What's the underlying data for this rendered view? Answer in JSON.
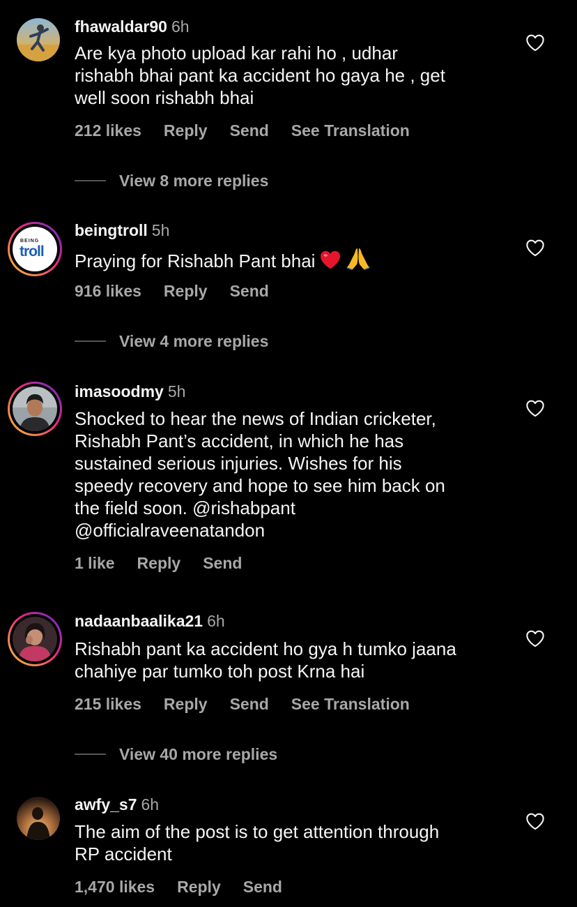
{
  "comments": [
    {
      "username": "fhawaldar90",
      "time": "6h",
      "text": "Are kya photo upload kar rahi ho , udhar\nrishabh bhai pant ka accident ho gaya he , get\nwell soon rishabh bhai",
      "likes": "212 likes",
      "reply": "Reply",
      "send": "Send",
      "translation": "See Translation",
      "view_replies": "View 8 more replies"
    },
    {
      "username": "beingtroll",
      "time": "5h",
      "text": "Praying for Rishabh Pant bhai",
      "likes": "916 likes",
      "reply": "Reply",
      "send": "Send",
      "view_replies": "View 4 more replies",
      "avatar_logo_top": "BEING",
      "avatar_logo_main": "troll"
    },
    {
      "username": "imasoodmy",
      "time": "5h",
      "text": "Shocked to hear the news of Indian cricketer,\nRishabh Pant’s accident, in which he has\nsustained serious injuries. Wishes for his\nspeedy recovery and hope to see him back on\nthe field soon. @rishabpant\n@officialraveenatandon",
      "likes": "1 like",
      "reply": "Reply",
      "send": "Send"
    },
    {
      "username": "nadaanbaalika21",
      "time": "6h",
      "text": "Rishabh pant ka accident ho gya h tumko jaana\nchahiye par tumko toh post Krna hai",
      "likes": "215 likes",
      "reply": "Reply",
      "send": "Send",
      "translation": "See Translation",
      "view_replies": "View 40 more replies"
    },
    {
      "username": "awfy_s7",
      "time": "6h",
      "text": "The aim of the post is to get attention through\nRP accident",
      "likes": "1,470 likes",
      "reply": "Reply",
      "send": "Send"
    }
  ],
  "icons": {
    "like": "heart-outline-icon",
    "emoji_heart": "red-heart-emoji",
    "emoji_pray": "folded-hands-emoji"
  },
  "colors": {
    "background": "#000000",
    "primary_text": "#f5f5f5",
    "secondary_text": "#a8a8a8",
    "story_ring_start": "#f9ce34",
    "story_ring_mid": "#ee2a7b",
    "story_ring_end": "#6228d7"
  }
}
